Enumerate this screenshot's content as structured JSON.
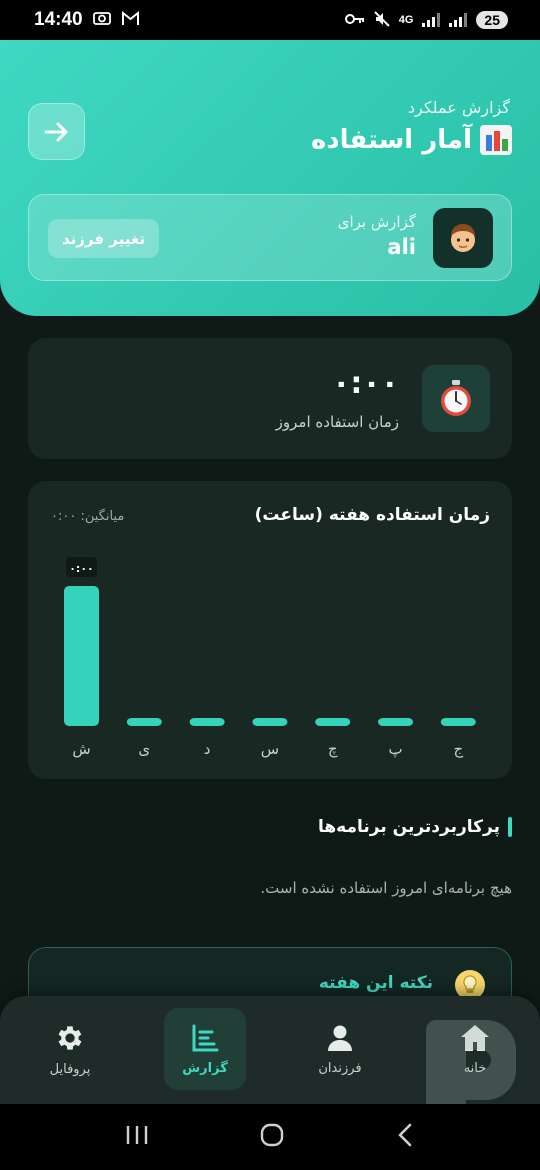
{
  "status_bar": {
    "time": "14:40",
    "network": "4G",
    "battery": "25",
    "icons": [
      "screenshot-icon",
      "gmail-icon",
      "key-icon",
      "mute-icon",
      "data-arrows-icon",
      "signal-icon",
      "signal-icon-2"
    ]
  },
  "header": {
    "subtitle": "گزارش عملکرد",
    "title": "آمار استفاده",
    "title_icon": "bar-chart-icon",
    "back_icon": "arrow-right-icon",
    "child_label": "گزارش برای",
    "child_name": "ali",
    "change_child_label": "تغییر فرزند"
  },
  "today": {
    "value": "۰:۰۰",
    "label": "زمان استفاده امروز",
    "icon": "stopwatch-icon"
  },
  "weekly": {
    "title": "زمان استفاده هفته (ساعت)",
    "average": "میانگین: ۰:۰۰"
  },
  "chart_data": {
    "type": "bar",
    "categories": [
      "ش",
      "ی",
      "د",
      "س",
      "چ",
      "پ",
      "ج"
    ],
    "values": [
      0,
      0,
      0,
      0,
      0,
      0,
      0
    ],
    "highlighted_index": 0,
    "highlighted_label": "۰:۰۰",
    "bar_color": "#35d3bc"
  },
  "most_used": {
    "title": "پرکاربردترین برنامه‌ها",
    "empty_text": "هیچ برنامه‌ای امروز استفاده نشده است."
  },
  "tip": {
    "title": "نکته این هفته",
    "icon": "lightbulb-icon"
  },
  "nav": {
    "items": [
      {
        "label": "پروفایل",
        "icon": "gear-icon"
      },
      {
        "label": "گزارش",
        "icon": "report-icon",
        "active": true
      },
      {
        "label": "فرزندان",
        "icon": "person-icon"
      },
      {
        "label": "خانه",
        "icon": "home-icon"
      }
    ]
  },
  "colors": {
    "accent": "#3fd8c2",
    "background": "#0f1a17",
    "card": "#1a2824"
  }
}
